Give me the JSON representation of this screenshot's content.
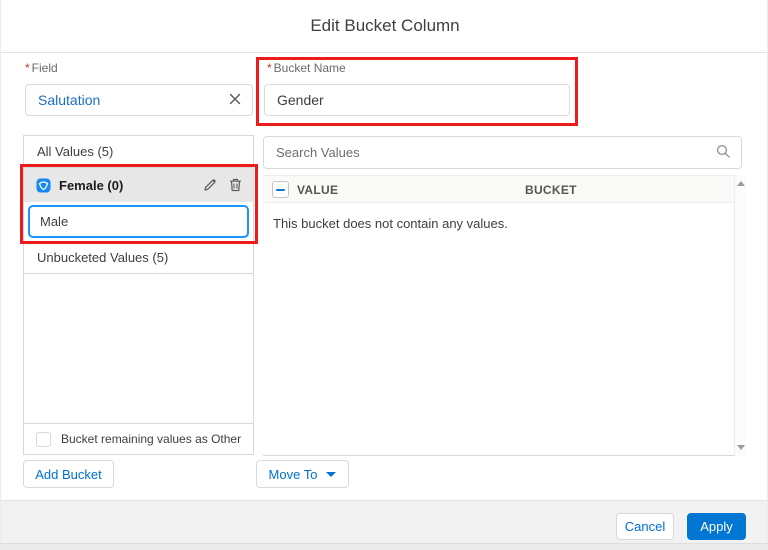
{
  "modal": {
    "title": "Edit Bucket Column"
  },
  "field_section": {
    "field": {
      "required": "*",
      "label": "Field",
      "value": "Salutation"
    },
    "bucket_name": {
      "required": "*",
      "label": "Bucket Name",
      "value": "Gender"
    }
  },
  "bucket_panel": {
    "all_values_label": "All Values (5)",
    "selected_bucket": {
      "name": "Female (0)"
    },
    "new_value_input": {
      "value": "Male"
    },
    "unbucketed_label": "Unbucketed Values (5)",
    "remaining_checkbox_label": "Bucket remaining values as Other",
    "add_bucket_button": "Add Bucket"
  },
  "values_panel": {
    "search": {
      "placeholder": "Search Values"
    },
    "table": {
      "columns": [
        "VALUE",
        "BUCKET"
      ],
      "empty_message": "This bucket does not contain any values."
    },
    "move_to_button": "Move To"
  },
  "footer": {
    "cancel_button": "Cancel",
    "apply_button": "Apply"
  },
  "colors": {
    "accent_blue": "#0176d3",
    "link_blue": "#0070d2",
    "input_text_blue": "#1b6ec2",
    "highlight_red": "#ec1c1c",
    "focus_border_blue": "#1b96ff",
    "selected_row_gray": "#e7e7e7",
    "footer_gray": "#f3f2f2"
  }
}
